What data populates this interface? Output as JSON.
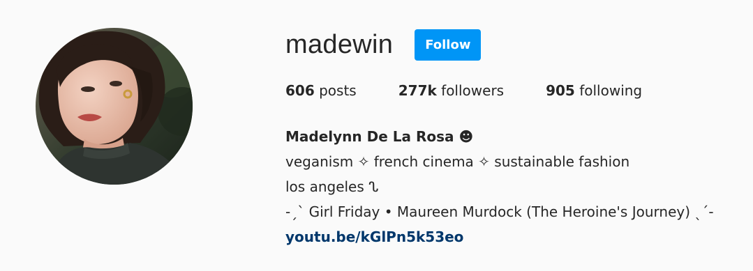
{
  "profile": {
    "username": "madewin",
    "follow_label": "Follow",
    "avatar_icon": "profile-photo",
    "stats": {
      "posts_count": "606",
      "posts_label": "posts",
      "followers_count": "277k",
      "followers_label": "followers",
      "following_count": "905",
      "following_label": "following"
    },
    "bio": {
      "full_name": "Madelynn De La Rosa ☻",
      "line1": "veganism ✧ french cinema ✧ sustainable fashion",
      "line2": "los angeles ᔐ",
      "line3": "-ˏˋ Girl Friday • Maureen Murdock (The Heroine's Journey) ˎˊ-",
      "link": "youtu.be/kGlPn5k53eo"
    }
  },
  "colors": {
    "background": "#fafafa",
    "text": "#262626",
    "follow_button": "#0095f6",
    "link": "#00376b"
  }
}
